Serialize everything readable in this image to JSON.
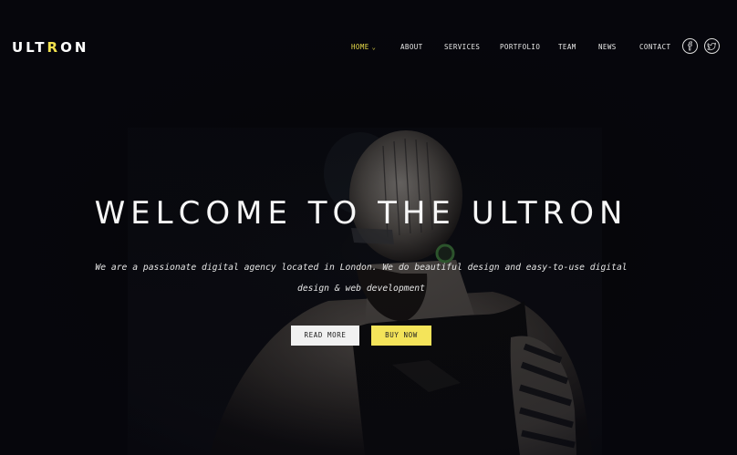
{
  "brand": {
    "logo_prefix": "ULT",
    "logo_accent": "R",
    "logo_suffix": "ON",
    "accent_color": "#f2e24e"
  },
  "nav": {
    "items": [
      {
        "label": "HOME",
        "active": true
      },
      {
        "label": "ABOUT"
      },
      {
        "label": "SERVICES"
      },
      {
        "label": "PORTFOLIO"
      },
      {
        "label": "TEAM"
      },
      {
        "label": "NEWS"
      },
      {
        "label": "CONTACT"
      }
    ],
    "social": [
      "facebook-icon",
      "twitter-icon"
    ]
  },
  "hero": {
    "title": "WELCOME TO THE ULTRON",
    "subtitle": "We are a passionate digital agency located in London. We do beautiful design and easy-to-use digital design & web development",
    "buttons": {
      "read_more": "READ MORE",
      "buy_now": "BUY NOW"
    }
  }
}
